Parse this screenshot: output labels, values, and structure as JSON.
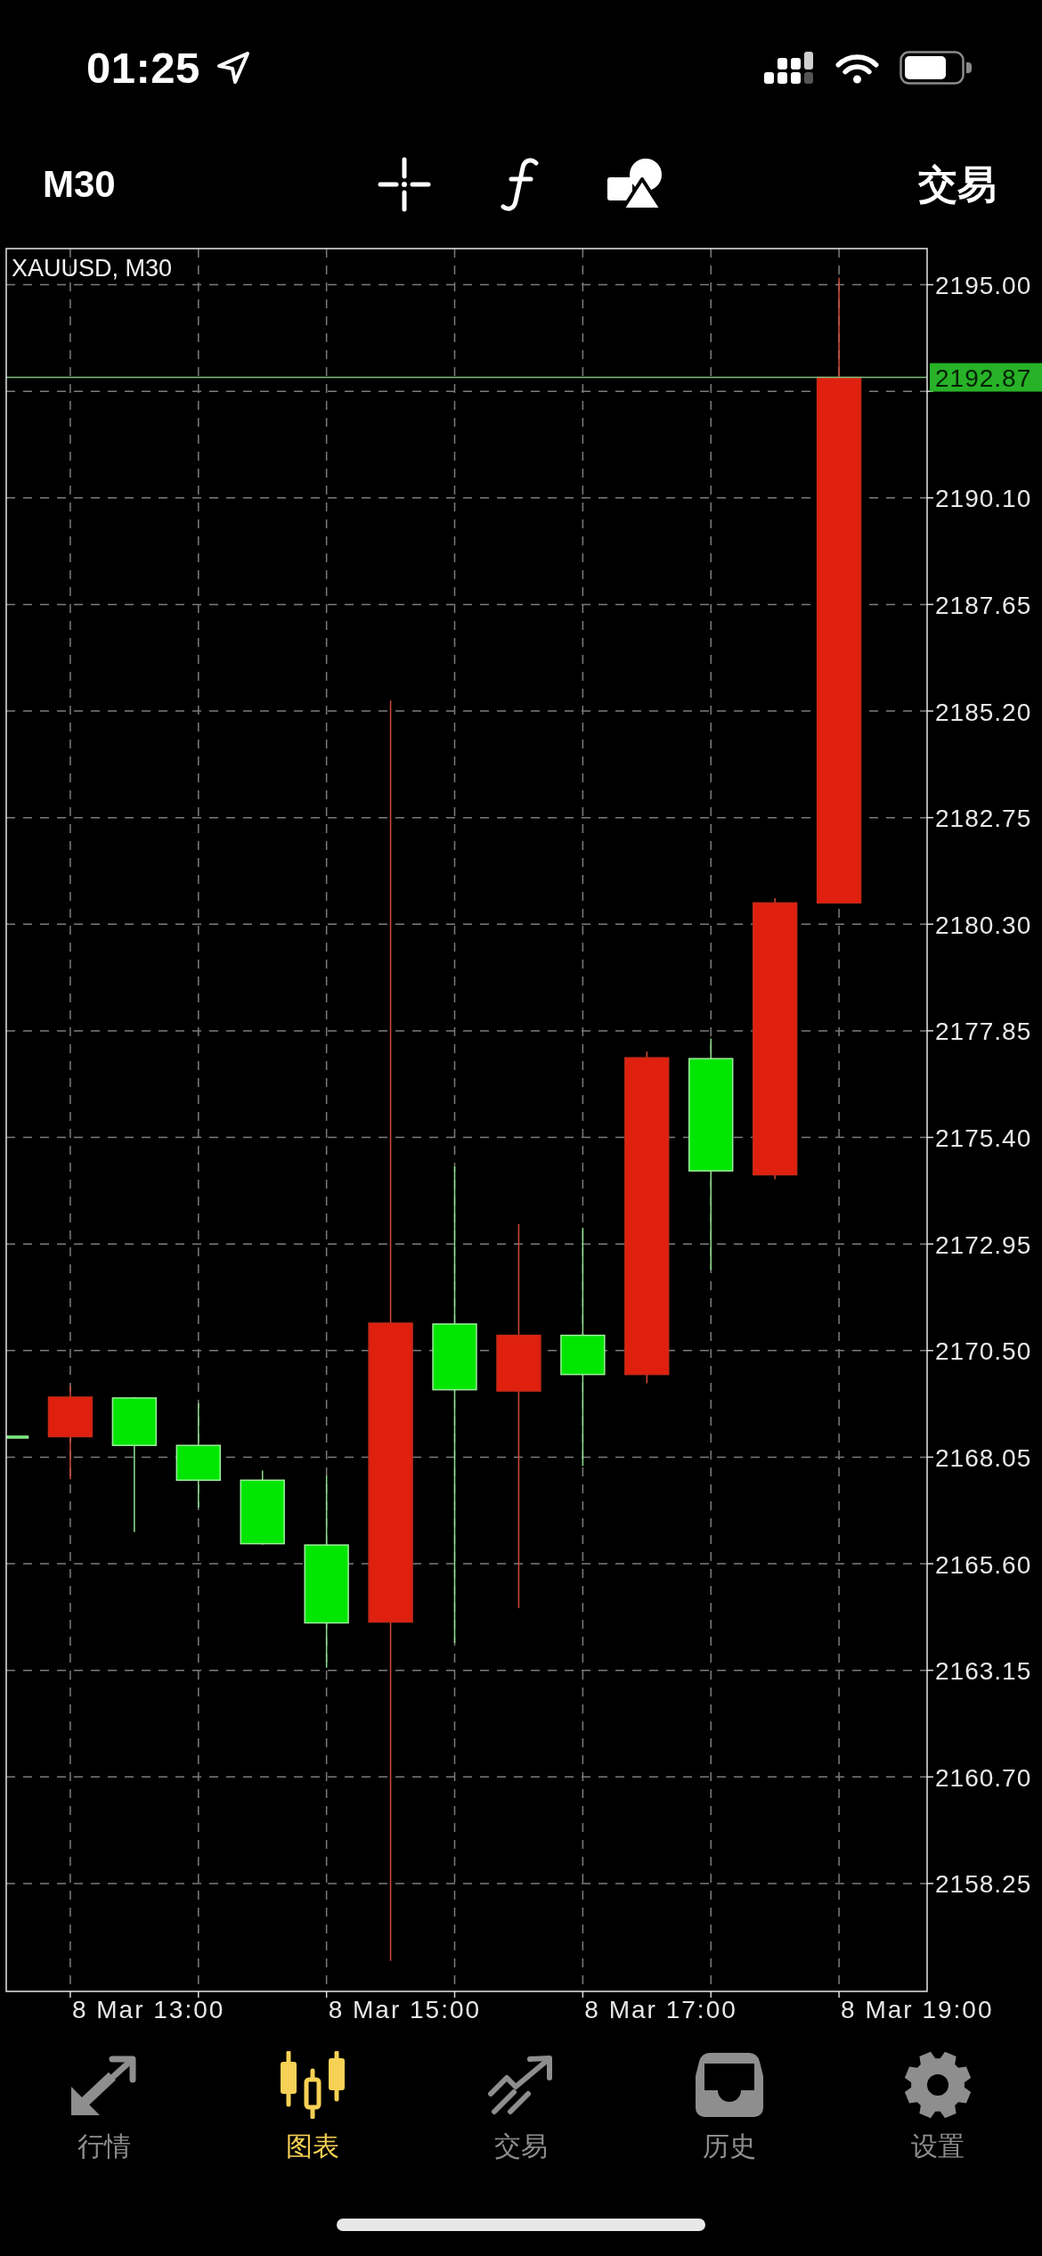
{
  "status_bar": {
    "time": "01:25"
  },
  "toolbar": {
    "timeframe": "M30",
    "trade_button": "交易"
  },
  "chart": {
    "title": "XAUUSD, M30",
    "price_labels": [
      "2195.00",
      "2190.10",
      "2187.65",
      "2185.20",
      "2182.75",
      "2180.30",
      "2177.85",
      "2175.40",
      "2172.95",
      "2170.50",
      "2168.05",
      "2165.60",
      "2163.15",
      "2160.70",
      "2158.25"
    ],
    "current_price": "2192.87",
    "time_labels": [
      "8 Mar 13:00",
      "8 Mar 15:00",
      "8 Mar 17:00",
      "8 Mar 19:00"
    ]
  },
  "tab_bar": {
    "tabs": [
      {
        "label": "行情",
        "selected": false
      },
      {
        "label": "图表",
        "selected": true
      },
      {
        "label": "交易",
        "selected": false
      },
      {
        "label": "历史",
        "selected": false
      },
      {
        "label": "设置",
        "selected": false
      }
    ]
  }
}
